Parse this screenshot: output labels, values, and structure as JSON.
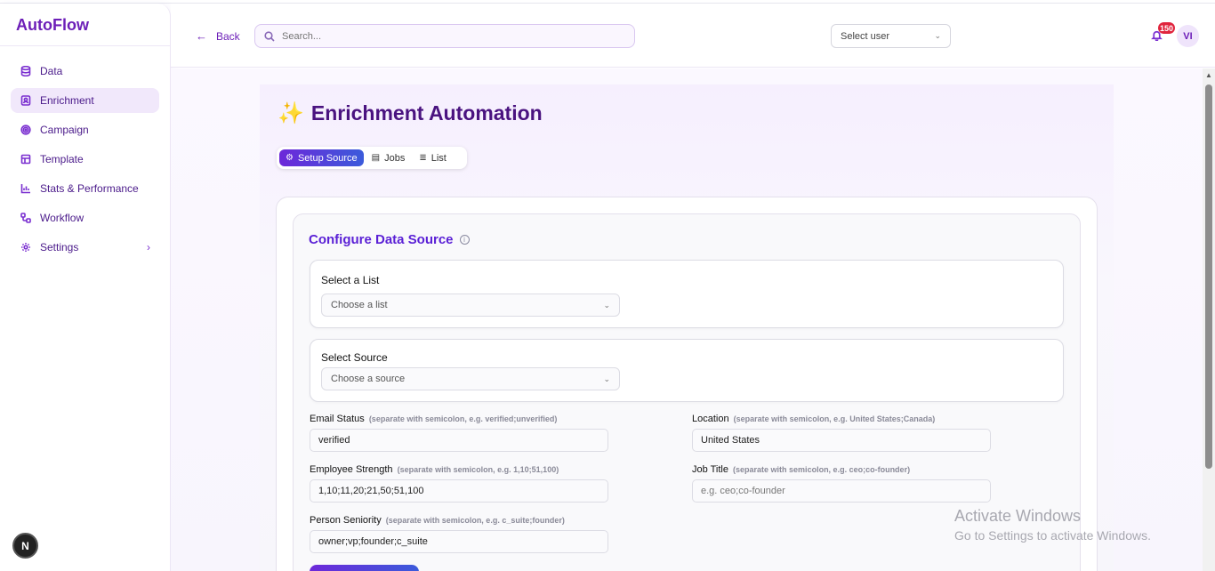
{
  "sidebar": {
    "brand": "AutoFlow",
    "items": [
      {
        "label": "Data",
        "icon": "database-icon"
      },
      {
        "label": "Enrichment",
        "icon": "contact-icon",
        "active": true
      },
      {
        "label": "Campaign",
        "icon": "target-icon"
      },
      {
        "label": "Template",
        "icon": "layout-icon"
      },
      {
        "label": "Stats & Performance",
        "icon": "bar-chart-icon"
      },
      {
        "label": "Workflow",
        "icon": "workflow-icon"
      },
      {
        "label": "Settings",
        "icon": "gear-icon",
        "has_submenu": true
      }
    ],
    "bottom_avatar": "N"
  },
  "header": {
    "back_label": "Back",
    "search_placeholder": "Search...",
    "user_select_placeholder": "Select user",
    "notification_count": "150",
    "user_initials": "VI"
  },
  "page": {
    "title": "Enrichment Automation",
    "tabs": [
      {
        "label": "Setup Source",
        "active": true
      },
      {
        "label": "Jobs"
      },
      {
        "label": "List"
      }
    ]
  },
  "config": {
    "title": "Configure Data Source",
    "list_label": "Select a List",
    "list_placeholder": "Choose a list",
    "source_label": "Select Source",
    "source_placeholder": "Choose a source",
    "fields": {
      "email_status": {
        "label": "Email Status",
        "hint": "(separate with semicolon, e.g. verified;unverified)",
        "value": "verified"
      },
      "location": {
        "label": "Location",
        "hint": "(separate with semicolon, e.g. United States;Canada)",
        "value": "United States"
      },
      "employee_strength": {
        "label": "Employee Strength",
        "hint": "(separate with semicolon, e.g. 1,10;51,100)",
        "value": "1,10;11,20;21,50;51,100"
      },
      "job_title": {
        "label": "Job Title",
        "hint": "(separate with semicolon, e.g. ceo;co-founder)",
        "placeholder": "e.g. ceo;co-founder"
      },
      "person_seniority": {
        "label": "Person Seniority",
        "hint": "(separate with semicolon, e.g. c_suite;founder)",
        "value": "owner;vp;founder;c_suite"
      }
    }
  },
  "watermark": {
    "line1": "Activate Windows",
    "line2": "Go to Settings to activate Windows."
  },
  "colors": {
    "brand": "#6d1fb8",
    "accent": "#5b21d6",
    "badge": "#e0243d"
  }
}
